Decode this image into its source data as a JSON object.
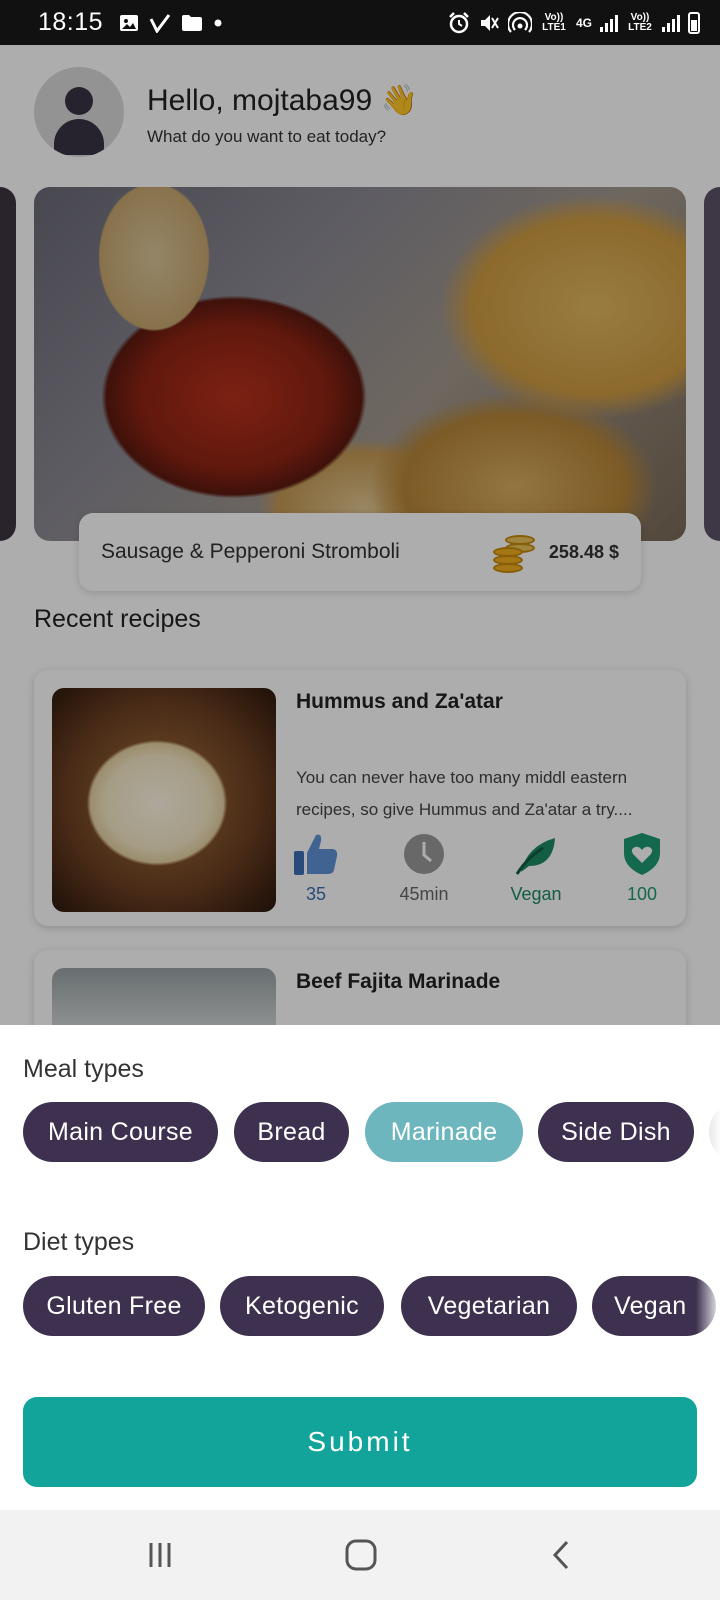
{
  "status_bar": {
    "time": "18:15",
    "left_icons": [
      "image-icon",
      "check-icon",
      "folder-icon",
      "dot-icon"
    ],
    "right_icons": [
      "alarm-icon",
      "mute-icon",
      "hotspot-icon",
      "signal-icon",
      "battery-icon"
    ],
    "sim1_label": "Vo)) LTE1",
    "network_label": "4G",
    "sim2_label": "Vo)) LTE2"
  },
  "header": {
    "greeting": "Hello, mojtaba99 👋",
    "subtitle": "What do you want to eat today?"
  },
  "featured": {
    "title": "Sausage & Pepperoni Stromboli",
    "price": "258.48 $"
  },
  "recent": {
    "section_title": "Recent recipes",
    "recipes": [
      {
        "title": "Hummus and Za'atar",
        "description": "You can never have too many middl eastern recipes, so give Hummus and Za'atar a try....",
        "likes": "35",
        "time": "45min",
        "diet": "Vegan",
        "health_score": "100"
      },
      {
        "title": "Beef Fajita Marinade"
      }
    ]
  },
  "filter_sheet": {
    "meal_types_label": "Meal types",
    "meal_types": [
      "Main Course",
      "Bread",
      "Marinade",
      "Side Dish"
    ],
    "selected_meal_type": "Marinade",
    "diet_types_label": "Diet types",
    "diet_types": [
      "Gluten Free",
      "Ketogenic",
      "Vegetarian",
      "Vegan"
    ],
    "submit_label": "Submit"
  },
  "colors": {
    "chip": "#3e3150",
    "chip_selected": "#6db6bd",
    "submit": "#12a39a",
    "like_blue": "#3a6fb5",
    "vegan_green": "#1d8a64"
  },
  "nav_bar": {
    "buttons": [
      "recent-apps-icon",
      "home-icon",
      "back-icon"
    ]
  }
}
